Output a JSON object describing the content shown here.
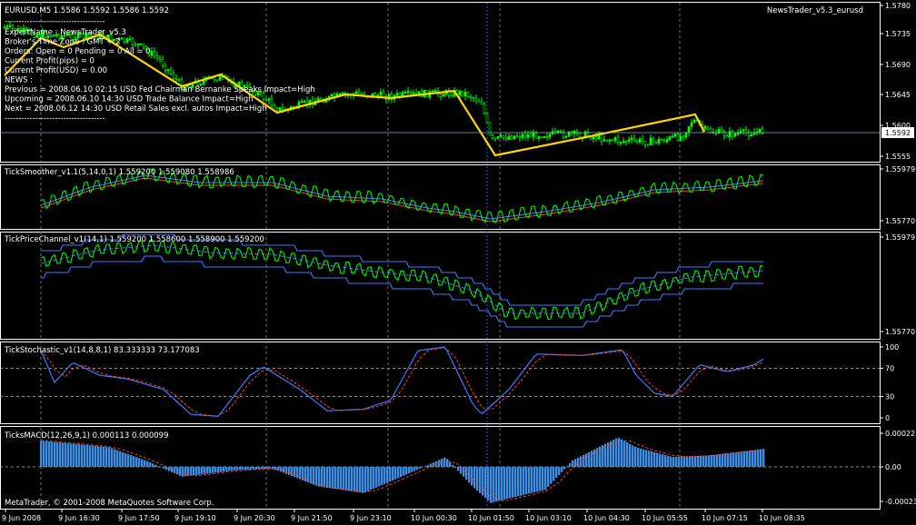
{
  "symbol_line": "EURUSD,M5  1.5586 1.5592 1.5586 1.5592",
  "ea_label": "NewsTrader_v5.3_eurusd",
  "copyright": "MetaTrader, © 2001-2008 MetaQuotes Software Corp.",
  "info_lines": [
    "ExpertName : NewsTrader_v5.3",
    "Broker's Time Zone : GMT + 2",
    "Orders: Open = 0 Pending = 0 All = 0",
    "Current Profit(pips) = 0",
    "Current Profit(USD) = 0.00",
    "NEWS :",
    "Previous = 2008.06.10 02:15 USD Fed Chairman Bernanke Speaks Impact=High",
    "Upcoming = 2008.06.10 14:30 USD Trade Balance Impact=High",
    "Next = 2008.06.12 14:30 USD Retail Sales excl. autos Impact=High"
  ],
  "info_separator": "------------------------------------",
  "price_ticks": [
    "1.5780",
    "1.5735",
    "1.5690",
    "1.5645",
    "1.5600",
    "1.5555"
  ],
  "current_price": "1.5592",
  "time_ticks": [
    "9 Jun 2008",
    "9 Jun 16:30",
    "9 Jun 17:50",
    "9 Jun 19:10",
    "9 Jun 20:30",
    "9 Jun 21:50",
    "9 Jun 23:10",
    "10 Jun 00:30",
    "10 Jun 01:50",
    "10 Jun 03:10",
    "10 Jun 04:30",
    "10 Jun 05:55",
    "10 Jun 07:15",
    "10 Jun 08:35"
  ],
  "panels": [
    {
      "name": "TickSmoother",
      "label": "TickSmoother_v1.1(5,14,0,1) 1.559200 1.559080 1.558986",
      "axis_top": "1.55979",
      "axis_bottom": "1.55770"
    },
    {
      "name": "TickPriceChannel",
      "label": "TickPriceChannel_v1(14,1) 1.559200 1.558600 1.558900 1.559200",
      "axis_top": "1.55979",
      "axis_bottom": "1.55770"
    },
    {
      "name": "TickStochastic",
      "label": "TickStochastic_v1(14,8,8,1) 83.333333 73.177083",
      "axis_ticks": [
        "100",
        "70",
        "30",
        "0"
      ]
    },
    {
      "name": "TicksMACD",
      "label": "TicksMACD(12,26,9,1) 0.000113 0.000099",
      "axis_ticks": [
        "0.00022",
        "0.00",
        "-0.00023"
      ]
    }
  ],
  "colors": {
    "background": "#000000",
    "bull": "#00ff00",
    "trend_line": "#ffd700",
    "blue": "#3a7cff",
    "red": "#ff3b30",
    "grid": "#ffffff"
  }
}
